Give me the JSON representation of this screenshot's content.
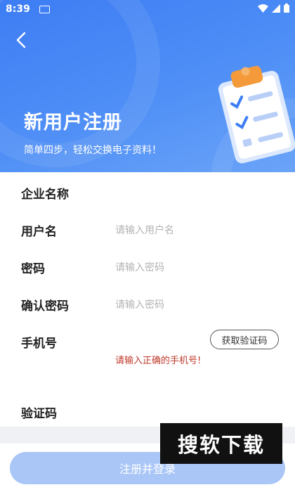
{
  "status_bar": {
    "time": "8:39",
    "icons": [
      "notification-icon",
      "wifi-icon",
      "signal-icon",
      "battery-icon"
    ]
  },
  "header": {
    "title": "新用户注册",
    "subtitle": "简单四步，轻松交换电子资料！",
    "back_icon": "back-arrow-icon",
    "illustration": "clipboard-checklist-icon"
  },
  "form": {
    "fields": [
      {
        "label": "企业名称",
        "placeholder": ""
      },
      {
        "label": "用户名",
        "placeholder": "请输入用户名"
      },
      {
        "label": "密码",
        "placeholder": "请输入密码"
      },
      {
        "label": "确认密码",
        "placeholder": "请输入密码"
      },
      {
        "label": "手机号",
        "placeholder": ""
      },
      {
        "label": "验证码",
        "placeholder": ""
      }
    ],
    "get_code_button": "获取验证码",
    "phone_error": "请输入正确的手机号!"
  },
  "submit_button": "注册并登录",
  "watermark": "搜软下载",
  "colors": {
    "header": "#4f8ff6",
    "button": "#a9c6f7",
    "error": "#c0392b"
  }
}
